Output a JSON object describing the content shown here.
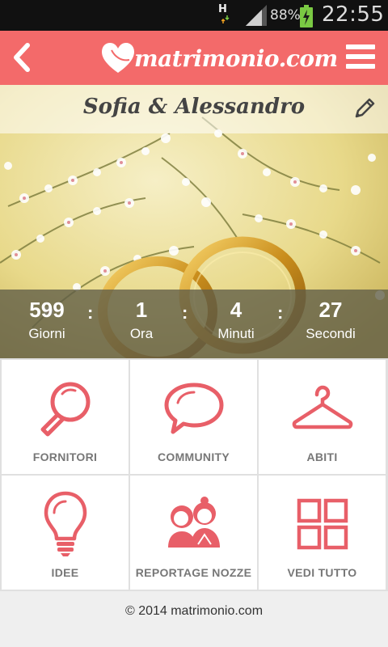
{
  "status_bar": {
    "network": "H",
    "battery_percent": "88%",
    "time": "22:55"
  },
  "app_bar": {
    "logo_text": "matrimonio.com",
    "accent_color": "#f36a6a"
  },
  "hero": {
    "couple_names": "Sofia & Alessandro"
  },
  "countdown": {
    "days": {
      "value": "599",
      "label": "Giorni"
    },
    "hours": {
      "value": "1",
      "label": "Ora"
    },
    "minutes": {
      "value": "4",
      "label": "Minuti"
    },
    "seconds": {
      "value": "27",
      "label": "Secondi"
    },
    "separator": ":"
  },
  "menu_tiles": [
    {
      "label": "FORNITORI",
      "icon": "search-icon"
    },
    {
      "label": "COMMUNITY",
      "icon": "speech-bubble-icon"
    },
    {
      "label": "ABITI",
      "icon": "hanger-icon"
    },
    {
      "label": "IDEE",
      "icon": "lightbulb-icon"
    },
    {
      "label": "REPORTAGE NOZZE",
      "icon": "couple-icon"
    },
    {
      "label": "VEDI TUTTO",
      "icon": "grid-icon"
    }
  ],
  "footer": {
    "copyright": "© 2014 matrimonio.com"
  }
}
